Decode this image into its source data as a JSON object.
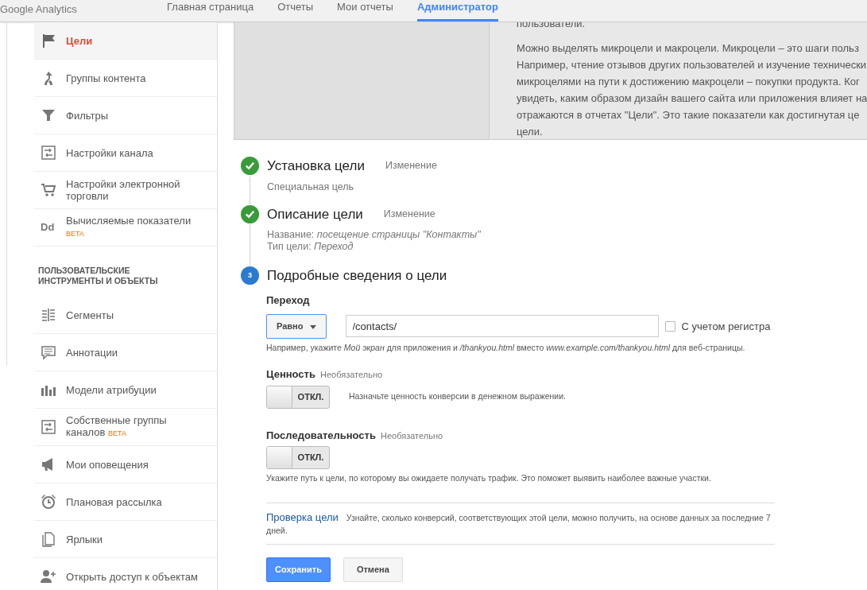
{
  "header": {
    "logo": "Google Analytics",
    "tabs": [
      {
        "label": "Главная страница",
        "selected": false
      },
      {
        "label": "Отчеты",
        "selected": false
      },
      {
        "label": "Мои отчеты",
        "selected": false
      },
      {
        "label": "Администратор",
        "selected": true
      }
    ]
  },
  "sidebar": {
    "items": [
      {
        "label": "Цели",
        "selected": true
      },
      {
        "label": "Группы контента",
        "selected": false
      },
      {
        "label": "Фильтры",
        "selected": false
      },
      {
        "label": "Настройки канала",
        "selected": false
      },
      {
        "label": "Настройки электронной торговли",
        "selected": false
      },
      {
        "label": "Вычисляемые показатели",
        "icon_text": "Dd",
        "badge": "BETA",
        "selected": false
      },
      {
        "kind": "heading",
        "label": "ПОЛЬЗОВАТЕЛЬСКИЕ ИНСТРУМЕНТЫ И ОБЪЕКТЫ"
      },
      {
        "label": "Сегменты",
        "selected": false
      },
      {
        "label": "Аннотации",
        "selected": false
      },
      {
        "label": "Модели атрибуции",
        "selected": false
      },
      {
        "label": "Собственные группы каналов",
        "badge": "BETA",
        "selected": false
      },
      {
        "label": "Мои оповещения",
        "selected": false
      },
      {
        "label": "Плановая рассылка",
        "selected": false
      },
      {
        "label": "Ярлыки",
        "selected": false
      },
      {
        "label": "Открыть доступ к объектам",
        "selected": false
      }
    ]
  },
  "info": {
    "paragraphs": [
      [
        "пользователи."
      ],
      [
        "Можно выделять микроцели и макроцели. Микроцели – это шаги польз",
        "Например, чтение отзывов других пользователей и изучение технически",
        "микроцелями на пути к достижению макроцели – покупки продукта. Ког",
        "увидеть, каким образом дизайн вашего сайта или приложения влияет на",
        "отражаются в отчетах \"Цели\". Это такие показатели как достигнутая це",
        "цели."
      ]
    ]
  },
  "steps": [
    {
      "done": true,
      "title": "Установка цели",
      "edit": "Изменение",
      "details": [
        {
          "text": "Специальная цель"
        }
      ]
    },
    {
      "done": true,
      "title": "Описание цели",
      "edit": "Изменение",
      "details": [
        {
          "label": "Название:",
          "value": "посещение страницы \"Контакты\""
        },
        {
          "label": "Тип цели:",
          "value": "Переход"
        }
      ]
    },
    {
      "done": false,
      "number": "3",
      "title": "Подробные сведения о цели"
    }
  ],
  "destination": {
    "label": "Переход",
    "match": "Равно",
    "value": "/contacts/",
    "case_sensitive": {
      "label": "С учетом регистра",
      "checked": false
    },
    "hint": "Например, укажите *Мой экран* для приложения и */thankyou.html* вместо *www.example.com/thankyou.html* для веб-страницы."
  },
  "options": [
    {
      "label": "Ценность",
      "optional": "Необязательно",
      "toggle": {
        "label": "ОТКЛ.",
        "on": false
      },
      "description": "Назначьте ценность конверсии в денежном выражении.",
      "kind": "inline"
    },
    {
      "label": "Последовательность",
      "optional": "Необязательно",
      "toggle": {
        "label": "ОТКЛ.",
        "on": false
      },
      "description": "Укажите путь к цели, по которому вы ожидаете получать трафик. Это поможет выявить наиболее важные участки.",
      "kind": "stacked"
    }
  ],
  "verify": {
    "link": "Проверка цели",
    "text": "Узнайте, сколько конверсий, соответствующих этой цели, можно получить, на основе данных за последние 7 дней."
  },
  "buttons": [
    {
      "label": "Сохранить",
      "kind": "primary"
    },
    {
      "label": "Отмена",
      "kind": "secondary"
    }
  ]
}
